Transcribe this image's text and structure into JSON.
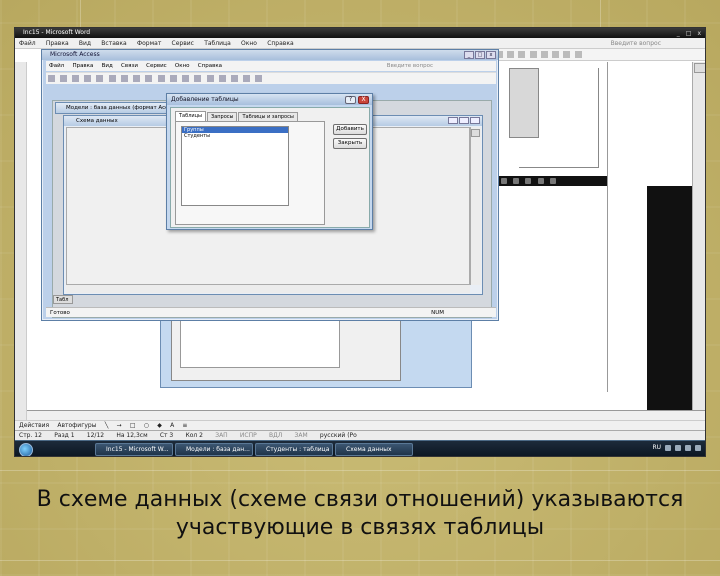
{
  "word": {
    "title": "Inc15 - Microsoft Word",
    "menu": [
      "Файл",
      "Правка",
      "Вид",
      "Вставка",
      "Формат",
      "Сервис",
      "Таблица",
      "Окно",
      "Справка"
    ],
    "search_hint": "Введите вопрос",
    "draw_toolbar": [
      "Действия",
      "Автофигуры"
    ],
    "status": {
      "page": "Стр. 12",
      "section": "Разд 1",
      "pages": "12/12",
      "position": "На 12,3см",
      "line": "Ст 3",
      "column": "Кол 2",
      "flags": [
        "ЗАП",
        "ИСПР",
        "ВДЛ",
        "ЗАМ"
      ],
      "language": "русский (Ро"
    }
  },
  "access": {
    "title": "Microsoft Access",
    "menu": [
      "Файл",
      "Правка",
      "Вид",
      "Связи",
      "Сервис",
      "Окно",
      "Справка"
    ],
    "search_hint": "Введите вопрос",
    "db_window_title": "Модели : база данных (формат Access)",
    "schema_window_title": "Схема данных",
    "tab_label": "Табл",
    "status_left": "Готово",
    "status_right": "NUM"
  },
  "add_table_dialog": {
    "title": "Добавление таблицы",
    "help": "?",
    "close": "X",
    "tabs": [
      "Таблицы",
      "Запросы",
      "Таблицы и запросы"
    ],
    "active_tab": "Таблицы",
    "tables": [
      {
        "name": "Группы",
        "selected": true
      },
      {
        "name": "Студенты",
        "selected": false
      }
    ],
    "add_button": "Добавить",
    "close_button": "Закрыть"
  },
  "taskbar": {
    "buttons": [
      "Inc15 - Microsoft W...",
      "Модели : база дан...",
      "Студенты : таблица",
      "Схема данных"
    ],
    "clock": "RU"
  },
  "caption": {
    "line1": "В схеме данных (схеме связи отношений) указываются",
    "line2": "участвующие в связях таблицы"
  }
}
